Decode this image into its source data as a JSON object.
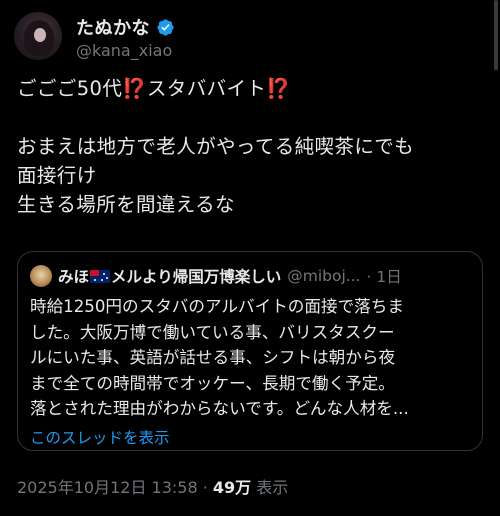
{
  "author": {
    "display_name": "たぬかな",
    "handle": "@kana_xiao",
    "verified_icon": "verified-badge-icon",
    "verified_color": "#1d9bf0"
  },
  "tweet": {
    "line1_text": "ごごご50代",
    "line1_mark_a": "⁉️",
    "line1_text_b": "スタババイト",
    "line1_mark_b": "⁉️",
    "line2": "おまえは地方で老人がやってる純喫茶にでも",
    "line3": "面接行け",
    "line4": "生きる場所を間違えるな"
  },
  "quote": {
    "name_a": "みほ",
    "flag_icon": "australia-flag-icon",
    "name_b": "メルより帰国万博楽しい",
    "handle": "@miboj...",
    "time": "· 1日",
    "lines": [
      "時給1250円のスタバのアルバイトの面接で落ちま",
      "した。大阪万博で働いている事、バリスタスクー",
      "ルにいた事、英語が話せる事、シフトは朝から夜",
      "まで全ての時間帯でオッケー、長期で働く予定。",
      "落とされた理由がわからないです。どんな人材を..."
    ],
    "thread_link": "このスレッドを表示"
  },
  "meta": {
    "timestamp": "2025年10月12日 13:58 · ",
    "views": "49万",
    "views_label": " 表示"
  },
  "colors": {
    "background": "#000000",
    "text": "#e7e9ea",
    "muted": "#71767b",
    "link": "#1d9bf0",
    "border": "#2f3336",
    "exclamation": "#f4212e"
  }
}
